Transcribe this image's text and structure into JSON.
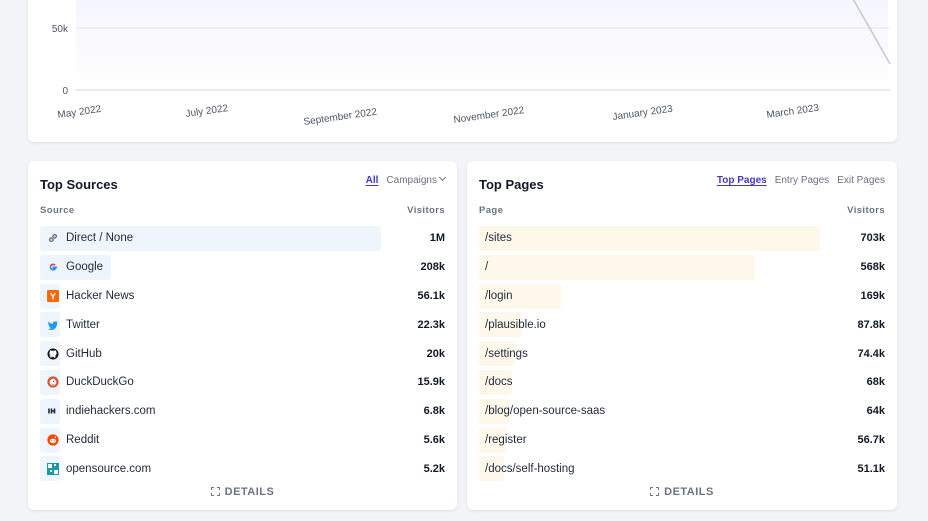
{
  "chart_data": {
    "type": "area",
    "x_ticks": [
      "May 2022",
      "July 2022",
      "September 2022",
      "November 2022",
      "January 2023",
      "March 2023"
    ],
    "y_ticks": [
      "0",
      "50k"
    ],
    "colors": {
      "line": "#6366f1",
      "fill": "#eef0fb",
      "grid": "#e5e7eb",
      "dashed_tail": "#c7cad4"
    }
  },
  "sources": {
    "title": "Top Sources",
    "tabs": [
      {
        "label": "All",
        "active": true
      },
      {
        "label": "Campaigns",
        "active": false
      }
    ],
    "col_source": "Source",
    "col_visitors": "Visitors",
    "items": [
      {
        "label": "Direct / None",
        "value": "1M",
        "icon": "link-icon",
        "share": 1.0
      },
      {
        "label": "Google",
        "value": "208k",
        "icon": "google-icon",
        "share": 0.208
      },
      {
        "label": "Hacker News",
        "value": "56.1k",
        "icon": "hackernews-icon",
        "share": 0.056
      },
      {
        "label": "Twitter",
        "value": "22.3k",
        "icon": "twitter-icon",
        "share": 0.022
      },
      {
        "label": "GitHub",
        "value": "20k",
        "icon": "github-icon",
        "share": 0.02
      },
      {
        "label": "DuckDuckGo",
        "value": "15.9k",
        "icon": "duckduckgo-icon",
        "share": 0.016
      },
      {
        "label": "indiehackers.com",
        "value": "6.8k",
        "icon": "indiehackers-icon",
        "share": 0.007
      },
      {
        "label": "Reddit",
        "value": "5.6k",
        "icon": "reddit-icon",
        "share": 0.006
      },
      {
        "label": "opensource.com",
        "value": "5.2k",
        "icon": "opensource-icon",
        "share": 0.005
      }
    ],
    "details_label": "DETAILS"
  },
  "pages": {
    "title": "Top Pages",
    "tabs": [
      {
        "label": "Top Pages",
        "active": true
      },
      {
        "label": "Entry Pages",
        "active": false
      },
      {
        "label": "Exit Pages",
        "active": false
      }
    ],
    "col_page": "Page",
    "col_visitors": "Visitors",
    "items": [
      {
        "label": "/sites",
        "value": "703k",
        "share": 1.0
      },
      {
        "label": "/",
        "value": "568k",
        "share": 0.808
      },
      {
        "label": "/login",
        "value": "169k",
        "share": 0.24
      },
      {
        "label": "/plausible.io",
        "value": "87.8k",
        "share": 0.125
      },
      {
        "label": "/settings",
        "value": "74.4k",
        "share": 0.106
      },
      {
        "label": "/docs",
        "value": "68k",
        "share": 0.097
      },
      {
        "label": "/blog/open-source-saas",
        "value": "64k",
        "share": 0.091
      },
      {
        "label": "/register",
        "value": "56.7k",
        "share": 0.081
      },
      {
        "label": "/docs/self-hosting",
        "value": "51.1k",
        "share": 0.073
      }
    ],
    "details_label": "DETAILS"
  }
}
